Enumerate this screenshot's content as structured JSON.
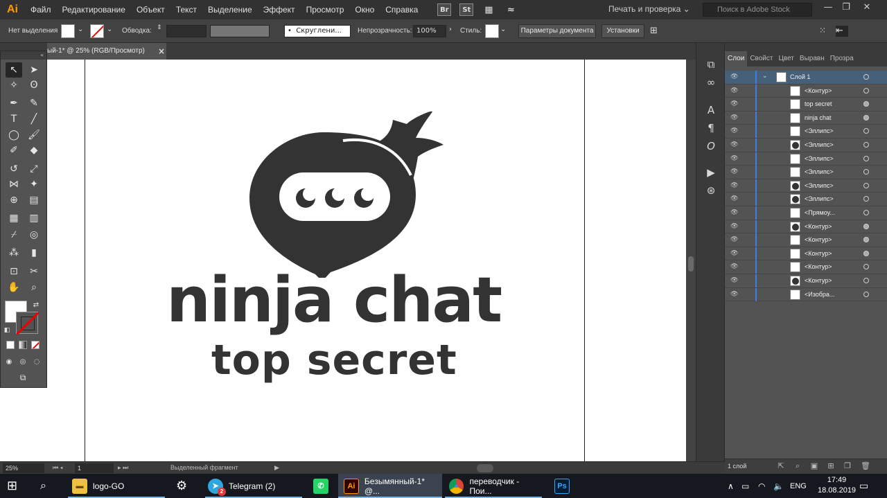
{
  "app": {
    "logo": "Ai",
    "menu": [
      "Файл",
      "Редактирование",
      "Объект",
      "Текст",
      "Выделение",
      "Эффект",
      "Просмотр",
      "Окно",
      "Справка"
    ],
    "bridge_label": "Br",
    "stock_label": "St",
    "workspace": "Печать и проверка",
    "search_placeholder": "Поиск в Adobe Stock"
  },
  "control_bar": {
    "selection_label": "Нет выделения",
    "stroke_label": "Обводка:",
    "brush_label": "Скруглени...",
    "opacity_label": "Непрозрачность:",
    "opacity_value": "100%",
    "style_label": "Стиль:",
    "doc_settings": "Параметры документа",
    "preferences": "Установки"
  },
  "document": {
    "tab_title": "ый-1* @ 25% (RGB/Просмотр)",
    "close": "×",
    "logo_title": "ninja chat",
    "logo_subtitle": "top secret",
    "ink_color": "#333333"
  },
  "status": {
    "zoom": "25%",
    "artboard": "1",
    "selection_info": "Выделенный фрагмент"
  },
  "layers_panel": {
    "tabs": [
      "Слои",
      "Свойст",
      "Цвет",
      "Выравн",
      "Прозра"
    ],
    "layer_name": "Слой 1",
    "items": [
      {
        "name": "<Контур>",
        "filled": false,
        "dark": false
      },
      {
        "name": "top secret",
        "filled": true,
        "dark": false
      },
      {
        "name": "ninja chat",
        "filled": true,
        "dark": false
      },
      {
        "name": "<Эллипс>",
        "filled": false,
        "dark": false
      },
      {
        "name": "<Эллипс>",
        "filled": false,
        "dark": true
      },
      {
        "name": "<Эллипс>",
        "filled": false,
        "dark": false
      },
      {
        "name": "<Эллипс>",
        "filled": false,
        "dark": false
      },
      {
        "name": "<Эллипс>",
        "filled": false,
        "dark": true
      },
      {
        "name": "<Эллипс>",
        "filled": false,
        "dark": true
      },
      {
        "name": "<Прямоу...",
        "filled": false,
        "dark": false
      },
      {
        "name": "<Контур>",
        "filled": true,
        "dark": true
      },
      {
        "name": "<Контур>",
        "filled": true,
        "dark": false
      },
      {
        "name": "<Контур>",
        "filled": true,
        "dark": false
      },
      {
        "name": "<Контур>",
        "filled": false,
        "dark": false
      },
      {
        "name": "<Контур>",
        "filled": false,
        "dark": true
      },
      {
        "name": "<Изобра...",
        "filled": false,
        "dark": false
      }
    ],
    "count": "1 слой"
  },
  "taskbar": {
    "items": [
      {
        "label": "logo-GO",
        "icon": "folder-icon"
      },
      {
        "label": "Telegram (2)",
        "icon": "telegram-icon"
      },
      {
        "label": "Безымянный-1* @...",
        "icon": "illustrator-icon"
      },
      {
        "label": "переводчик - Пои...",
        "icon": "chrome-icon"
      }
    ],
    "telegram_badge": "2",
    "language": "ENG",
    "time": "17:49",
    "date": "18.08.2019"
  }
}
